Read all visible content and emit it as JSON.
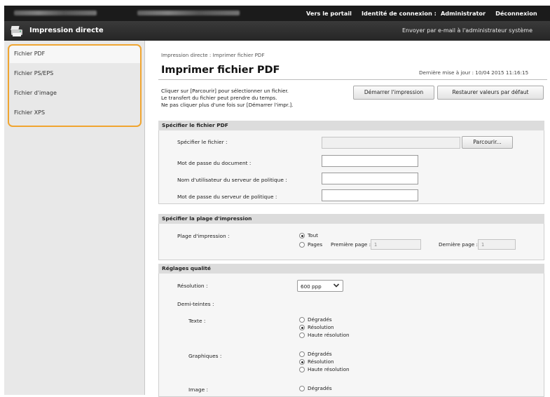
{
  "topbar": {
    "portal": "Vers le portail",
    "login_label": "Identité de connexion :",
    "user": "Administrator",
    "logout": "Déconnexion"
  },
  "titlebar": {
    "app_title": "Impression directe",
    "mail_admin": "Envoyer par e-mail à l'administrateur système"
  },
  "sidebar": {
    "items": [
      {
        "label": "Fichier PDF",
        "active": true
      },
      {
        "label": "Fichier PS/EPS"
      },
      {
        "label": "Fichier d'image"
      },
      {
        "label": "Fichier XPS"
      }
    ]
  },
  "main": {
    "breadcrumb": "Impression directe : Imprimer fichier PDF",
    "title": "Imprimer fichier PDF",
    "last_update": "Dernière mise à jour : 10/04 2015 11:16:15",
    "intro": [
      "Cliquer sur [Parcourir] pour sélectionner un fichier.",
      "Le transfert du fichier peut prendre du temps.",
      "Ne pas cliquer plus d'une fois sur [Démarrer l'impr.]."
    ],
    "start_button": "Démarrer l'impression",
    "restore_button": "Restaurer valeurs par défaut"
  },
  "file_section": {
    "header": "Spécifier le fichier PDF",
    "file_label": "Spécifier le fichier :",
    "browse_button": "Parcourir...",
    "doc_password_label": "Mot de passe du document :",
    "policy_user_label": "Nom d'utilisateur du serveur de politique :",
    "policy_password_label": "Mot de passe du serveur de politique :"
  },
  "range_section": {
    "header": "Spécifier la plage d'impression",
    "range_label": "Plage d'impression :",
    "all_option": "Tout",
    "pages_option": "Pages",
    "first_page_label": "Première page :",
    "first_page_value": "1",
    "last_page_label": "Dernière page :",
    "last_page_value": "1"
  },
  "quality_section": {
    "header": "Réglages qualité",
    "resolution_label": "Résolution :",
    "resolution_value": "600 ppp",
    "halftone_label": "Demi-teintes :",
    "text_label": "Texte :",
    "graphics_label": "Graphiques :",
    "image_label": "Image :",
    "opt_gradation": "Dégradés",
    "opt_resolution": "Résolution",
    "opt_high_resolution": "Haute résolution"
  },
  "colors": {
    "highlight": "#f0a530",
    "topbar": "#1b1b1b"
  }
}
